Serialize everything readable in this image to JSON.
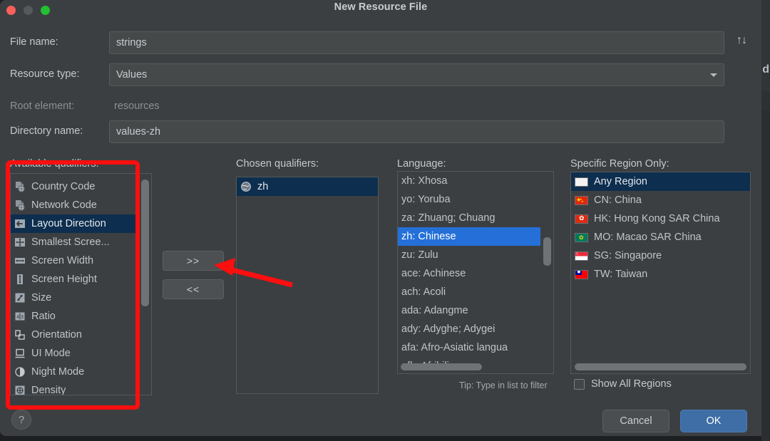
{
  "window": {
    "title": "New Resource File",
    "traffic_lights": [
      "close",
      "minimize",
      "maximize"
    ]
  },
  "background": {
    "partial_letter": "d"
  },
  "form": {
    "file_name": {
      "label": "File name:",
      "value": "strings"
    },
    "resource_type": {
      "label": "Resource type:",
      "value": "Values"
    },
    "root_element": {
      "label": "Root element:",
      "value": "resources"
    },
    "directory_name": {
      "label": "Directory name:",
      "value": "values-zh"
    },
    "sort_icon": "↑↓"
  },
  "available_qualifiers": {
    "heading": "Available qualifiers:",
    "items": [
      {
        "label": "Country Code",
        "icon": "country-code-icon",
        "selected": false
      },
      {
        "label": "Network Code",
        "icon": "network-code-icon",
        "selected": false
      },
      {
        "label": "Layout Direction",
        "icon": "layout-direction-icon",
        "selected": true
      },
      {
        "label": "Smallest Scree...",
        "icon": "smallest-screen-icon",
        "selected": false
      },
      {
        "label": "Screen Width",
        "icon": "screen-width-icon",
        "selected": false
      },
      {
        "label": "Screen Height",
        "icon": "screen-height-icon",
        "selected": false
      },
      {
        "label": "Size",
        "icon": "size-icon",
        "selected": false
      },
      {
        "label": "Ratio",
        "icon": "ratio-icon",
        "selected": false
      },
      {
        "label": "Orientation",
        "icon": "orientation-icon",
        "selected": false
      },
      {
        "label": "UI Mode",
        "icon": "ui-mode-icon",
        "selected": false
      },
      {
        "label": "Night Mode",
        "icon": "night-mode-icon",
        "selected": false
      },
      {
        "label": "Density",
        "icon": "density-icon",
        "selected": false
      }
    ]
  },
  "transfer": {
    "add_label": ">>",
    "remove_label": "<<"
  },
  "chosen_qualifiers": {
    "heading": "Chosen qualifiers:",
    "items": [
      {
        "label": "zh",
        "icon": "globe-icon",
        "selected": true
      }
    ]
  },
  "language": {
    "heading": "Language:",
    "tip": "Tip: Type in list to filter",
    "items": [
      {
        "label": "xh: Xhosa",
        "selected": false
      },
      {
        "label": "yo: Yoruba",
        "selected": false
      },
      {
        "label": "za: Zhuang; Chuang",
        "selected": false
      },
      {
        "label": "zh: Chinese",
        "selected": true
      },
      {
        "label": "zu: Zulu",
        "selected": false
      },
      {
        "label": "ace: Achinese",
        "selected": false
      },
      {
        "label": "ach: Acoli",
        "selected": false
      },
      {
        "label": "ada: Adangme",
        "selected": false
      },
      {
        "label": "ady: Adyghe; Adygei",
        "selected": false
      },
      {
        "label": "afa: Afro-Asiatic langua",
        "selected": false
      },
      {
        "label": "afh: Afrihili",
        "selected": false
      }
    ]
  },
  "specific_region": {
    "heading": "Specific Region Only:",
    "items": [
      {
        "label": "Any Region",
        "flag": "any",
        "selected": true
      },
      {
        "label": "CN: China",
        "flag": "cn",
        "selected": false
      },
      {
        "label": "HK: Hong Kong SAR China",
        "flag": "hk",
        "selected": false
      },
      {
        "label": "MO: Macao SAR China",
        "flag": "mo",
        "selected": false
      },
      {
        "label": "SG: Singapore",
        "flag": "sg",
        "selected": false
      },
      {
        "label": "TW: Taiwan",
        "flag": "tw",
        "selected": false
      }
    ],
    "show_all": {
      "label": "Show All Regions",
      "checked": false
    }
  },
  "footer": {
    "help_label": "?",
    "cancel_label": "Cancel",
    "ok_label": "OK"
  },
  "colors": {
    "dialog_bg": "#3c3f41",
    "selection_blue": "#2470d8",
    "selection_dark": "#0d2e4e",
    "ok_button": "#3e6ea5",
    "annotation_red": "#fb0f0f"
  }
}
